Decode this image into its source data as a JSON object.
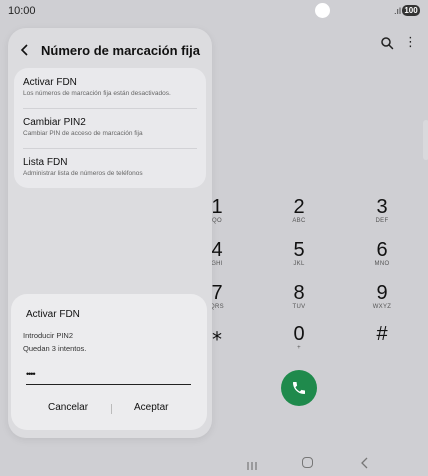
{
  "status_bar": {
    "time": "10:00",
    "battery": "100",
    "signal": ".ıl"
  },
  "dialer": {
    "keys": [
      {
        "digit": "1",
        "letters": "QO"
      },
      {
        "digit": "2",
        "letters": "ABC"
      },
      {
        "digit": "3",
        "letters": "DEF"
      },
      {
        "digit": "4",
        "letters": "GHI"
      },
      {
        "digit": "5",
        "letters": "JKL"
      },
      {
        "digit": "6",
        "letters": "MNO"
      },
      {
        "digit": "7",
        "letters": "QRS"
      },
      {
        "digit": "8",
        "letters": "TUV"
      },
      {
        "digit": "9",
        "letters": "WXYZ"
      },
      {
        "digit": "⁎",
        "letters": ""
      },
      {
        "digit": "0",
        "letters": "+"
      },
      {
        "digit": "#",
        "letters": ""
      }
    ],
    "call_color": "#1f8a4c",
    "more_icon": "⋮"
  },
  "panel": {
    "title": "Número de marcación fija",
    "items": [
      {
        "title": "Activar FDN",
        "subtitle": "Los números de marcación fija están desactivados."
      },
      {
        "title": "Cambiar PIN2",
        "subtitle": "Cambiar PIN de acceso de marcación fija"
      },
      {
        "title": "Lista FDN",
        "subtitle": "Administrar lista de números de teléfonos"
      }
    ]
  },
  "dialog": {
    "title": "Activar FDN",
    "line1": "Introducir PIN2",
    "line2": "Quedan 3 intentos.",
    "pin_value": "••••",
    "cancel_label": "Cancelar",
    "ok_label": "Aceptar"
  }
}
